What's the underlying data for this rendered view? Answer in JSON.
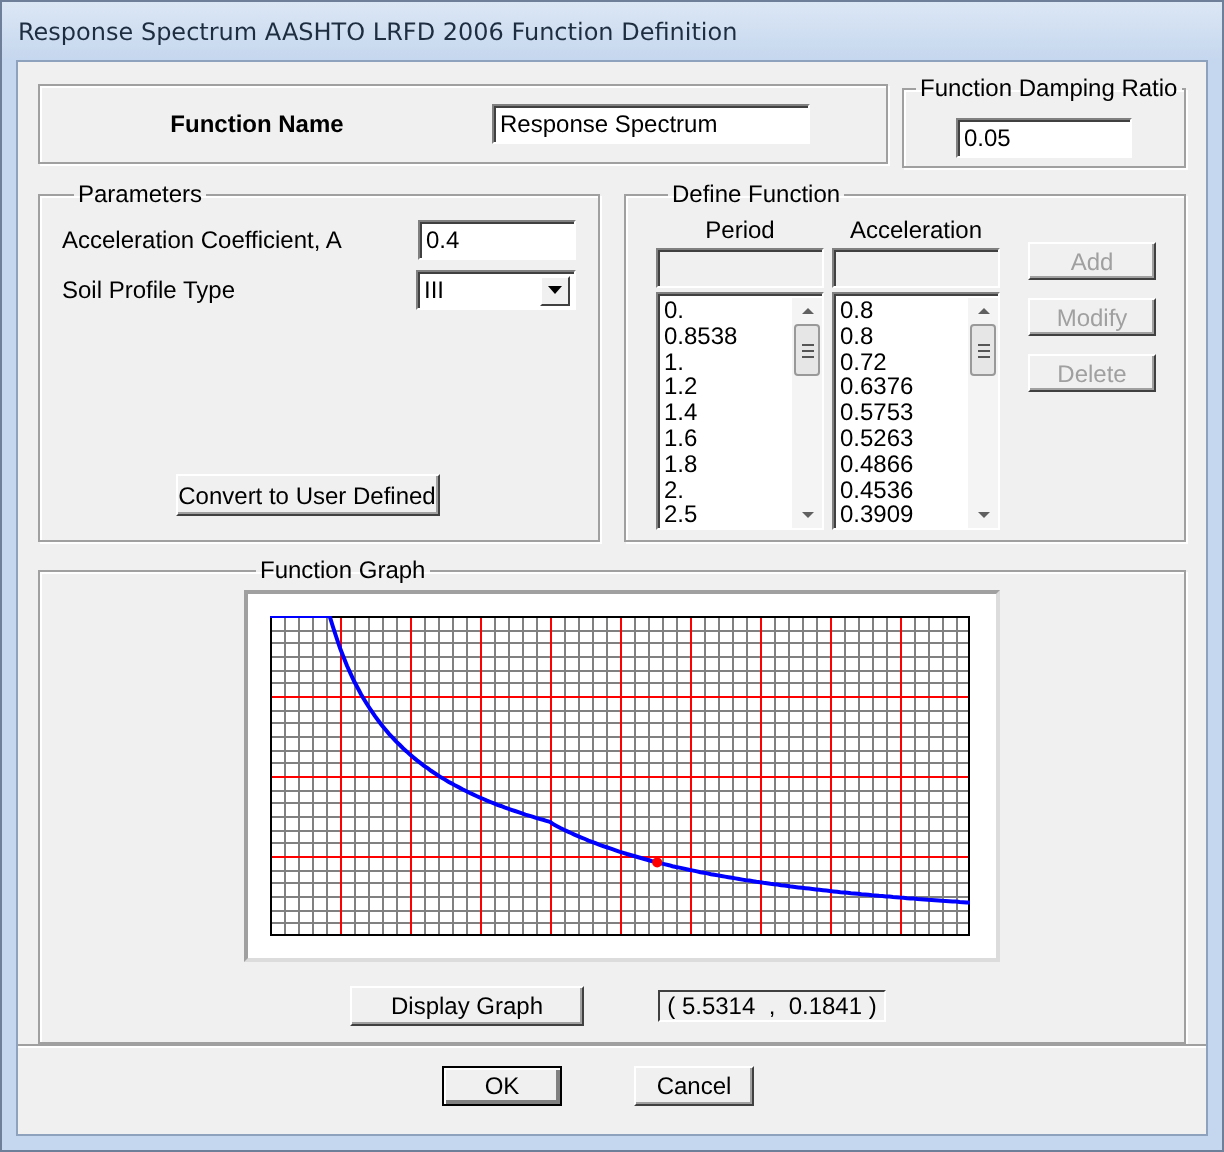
{
  "window": {
    "title": "Response Spectrum AASHTO LRFD 2006 Function Definition"
  },
  "function_name": {
    "label": "Function Name",
    "value": "Response Spectrum"
  },
  "damping": {
    "title": "Function Damping Ratio",
    "value": "0.05"
  },
  "parameters": {
    "title": "Parameters",
    "fields": [
      {
        "kind": "text",
        "label": "Acceleration Coefficient, A",
        "value": "0.4"
      },
      {
        "kind": "dropdown",
        "label": "Soil Profile Type",
        "value": "III"
      }
    ],
    "button": "Convert to User Defined"
  },
  "define_function": {
    "title": "Define Function",
    "columns": [
      {
        "header": "Period",
        "values": [
          "0.",
          "0.8538",
          "1.",
          "1.2",
          "1.4",
          "1.6",
          "1.8",
          "2.",
          "2.5"
        ]
      },
      {
        "header": "Acceleration",
        "values": [
          "0.8",
          "0.8",
          "0.72",
          "0.6376",
          "0.5753",
          "0.5263",
          "0.4866",
          "0.4536",
          "0.3909"
        ]
      }
    ],
    "buttons": [
      {
        "label": "Add",
        "disabled": true
      },
      {
        "label": "Modify",
        "disabled": true
      },
      {
        "label": "Delete",
        "disabled": true
      }
    ]
  },
  "graph": {
    "title": "Function Graph",
    "button": "Display Graph",
    "readout": "( 5.5314  ,  0.1841 )"
  },
  "buttons": [
    {
      "label": "OK",
      "default": true
    },
    {
      "label": "Cancel",
      "default": false
    }
  ]
}
